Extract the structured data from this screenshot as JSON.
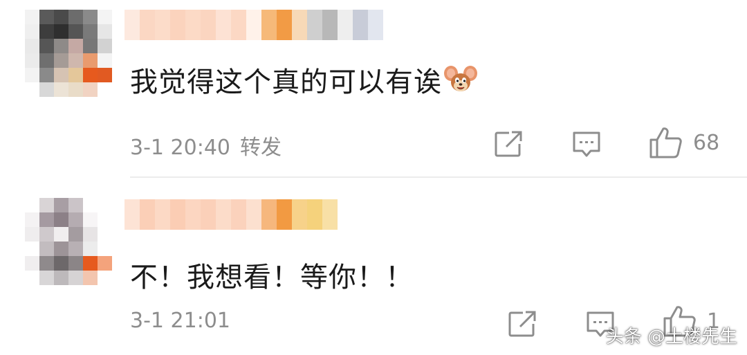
{
  "comments": [
    {
      "text": "我觉得这个真的可以有诶",
      "emoji": "jerry-mouse-emoji",
      "timestamp": "3-1 20:40",
      "repost_label": "转发",
      "like_count": "68"
    },
    {
      "text": "不！我想看！等你！！",
      "timestamp": "3-1 21:01",
      "like_count": "1"
    }
  ],
  "icons": {
    "share": "share-icon",
    "reply": "comment-icon",
    "like": "thumbs-up-icon"
  },
  "watermark": "头条 @土楼先生",
  "colors": {
    "meta_text": "#8d8d8d",
    "body_text": "#1a1a1a",
    "divider": "#ececec"
  }
}
